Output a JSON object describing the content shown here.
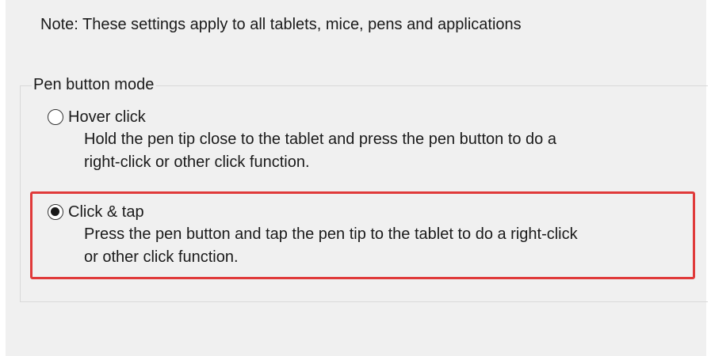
{
  "note": {
    "text": "Note: These settings apply to all tablets, mice, pens and applications"
  },
  "pen_button_mode": {
    "group_label": "Pen button mode",
    "options": [
      {
        "label": "Hover click",
        "selected": false,
        "description_lines": [
          "Hold the pen tip close to the tablet and press the pen button to do a",
          "right-click or other click function."
        ]
      },
      {
        "label": "Click & tap",
        "selected": true,
        "description_lines": [
          "Press the pen button and tap the pen tip to the tablet to do a right-click",
          "or other click function."
        ]
      }
    ]
  },
  "colors": {
    "highlight_border": "#e03a3a",
    "panel_background": "#f0f0f0"
  }
}
